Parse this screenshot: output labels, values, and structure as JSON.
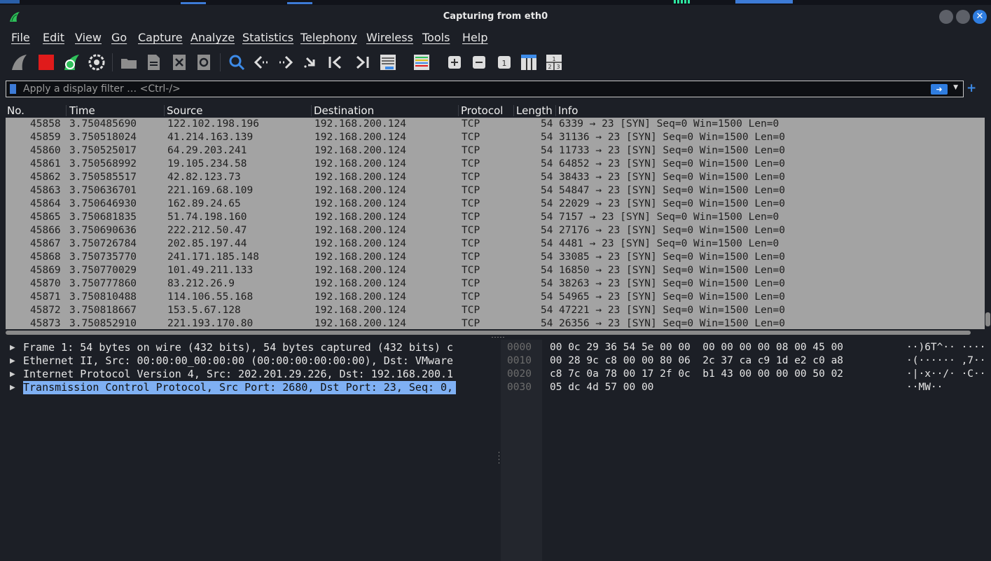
{
  "window": {
    "title": "Capturing from eth0"
  },
  "menu": [
    "File",
    "Edit",
    "View",
    "Go",
    "Capture",
    "Analyze",
    "Statistics",
    "Telephony",
    "Wireless",
    "Tools",
    "Help"
  ],
  "filter": {
    "placeholder": "Apply a display filter … <Ctrl-/>"
  },
  "columns": [
    "No.",
    "Time",
    "Source",
    "Destination",
    "Protocol",
    "Length",
    "Info"
  ],
  "packets": [
    {
      "no": "45858",
      "time": "3.750485690",
      "src": "122.102.198.196",
      "dst": "192.168.200.124",
      "proto": "TCP",
      "len": "54",
      "info": "6339 → 23 [SYN] Seq=0 Win=1500 Len=0"
    },
    {
      "no": "45859",
      "time": "3.750518024",
      "src": "41.214.163.139",
      "dst": "192.168.200.124",
      "proto": "TCP",
      "len": "54",
      "info": "31136 → 23 [SYN] Seq=0 Win=1500 Len=0"
    },
    {
      "no": "45860",
      "time": "3.750525017",
      "src": "64.29.203.241",
      "dst": "192.168.200.124",
      "proto": "TCP",
      "len": "54",
      "info": "11733 → 23 [SYN] Seq=0 Win=1500 Len=0"
    },
    {
      "no": "45861",
      "time": "3.750568992",
      "src": "19.105.234.58",
      "dst": "192.168.200.124",
      "proto": "TCP",
      "len": "54",
      "info": "64852 → 23 [SYN] Seq=0 Win=1500 Len=0"
    },
    {
      "no": "45862",
      "time": "3.750585517",
      "src": "42.82.123.73",
      "dst": "192.168.200.124",
      "proto": "TCP",
      "len": "54",
      "info": "38433 → 23 [SYN] Seq=0 Win=1500 Len=0"
    },
    {
      "no": "45863",
      "time": "3.750636701",
      "src": "221.169.68.109",
      "dst": "192.168.200.124",
      "proto": "TCP",
      "len": "54",
      "info": "54847 → 23 [SYN] Seq=0 Win=1500 Len=0"
    },
    {
      "no": "45864",
      "time": "3.750646930",
      "src": "162.89.24.65",
      "dst": "192.168.200.124",
      "proto": "TCP",
      "len": "54",
      "info": "22029 → 23 [SYN] Seq=0 Win=1500 Len=0"
    },
    {
      "no": "45865",
      "time": "3.750681835",
      "src": "51.74.198.160",
      "dst": "192.168.200.124",
      "proto": "TCP",
      "len": "54",
      "info": "7157 → 23 [SYN] Seq=0 Win=1500 Len=0"
    },
    {
      "no": "45866",
      "time": "3.750690636",
      "src": "222.212.50.47",
      "dst": "192.168.200.124",
      "proto": "TCP",
      "len": "54",
      "info": "27176 → 23 [SYN] Seq=0 Win=1500 Len=0"
    },
    {
      "no": "45867",
      "time": "3.750726784",
      "src": "202.85.197.44",
      "dst": "192.168.200.124",
      "proto": "TCP",
      "len": "54",
      "info": "4481 → 23 [SYN] Seq=0 Win=1500 Len=0"
    },
    {
      "no": "45868",
      "time": "3.750735770",
      "src": "241.171.185.148",
      "dst": "192.168.200.124",
      "proto": "TCP",
      "len": "54",
      "info": "33085 → 23 [SYN] Seq=0 Win=1500 Len=0"
    },
    {
      "no": "45869",
      "time": "3.750770029",
      "src": "101.49.211.133",
      "dst": "192.168.200.124",
      "proto": "TCP",
      "len": "54",
      "info": "16850 → 23 [SYN] Seq=0 Win=1500 Len=0"
    },
    {
      "no": "45870",
      "time": "3.750777860",
      "src": "83.212.26.9",
      "dst": "192.168.200.124",
      "proto": "TCP",
      "len": "54",
      "info": "38263 → 23 [SYN] Seq=0 Win=1500 Len=0"
    },
    {
      "no": "45871",
      "time": "3.750810488",
      "src": "114.106.55.168",
      "dst": "192.168.200.124",
      "proto": "TCP",
      "len": "54",
      "info": "54965 → 23 [SYN] Seq=0 Win=1500 Len=0"
    },
    {
      "no": "45872",
      "time": "3.750818667",
      "src": "153.5.67.128",
      "dst": "192.168.200.124",
      "proto": "TCP",
      "len": "54",
      "info": "47221 → 23 [SYN] Seq=0 Win=1500 Len=0"
    },
    {
      "no": "45873",
      "time": "3.750852910",
      "src": "221.193.170.80",
      "dst": "192.168.200.124",
      "proto": "TCP",
      "len": "54",
      "info": "26356 → 23 [SYN] Seq=0 Win=1500 Len=0"
    }
  ],
  "details": [
    {
      "text": "Frame 1: 54 bytes on wire (432 bits), 54 bytes captured (432 bits) c",
      "selected": false
    },
    {
      "text": "Ethernet II, Src: 00:00:00_00:00:00 (00:00:00:00:00:00), Dst: VMware",
      "selected": false
    },
    {
      "text": "Internet Protocol Version 4, Src: 202.201.29.226, Dst: 192.168.200.1",
      "selected": false
    },
    {
      "text": "Transmission Control Protocol, Src Port: 2680, Dst Port: 23, Seq: 0,",
      "selected": true
    }
  ],
  "hex": [
    {
      "offset": "0000",
      "bytes": "00 0c 29 36 54 5e 00 00  00 00 00 00 08 00 45 00",
      "ascii": "··)6T^·· ····"
    },
    {
      "offset": "0010",
      "bytes": "00 28 9c c8 00 00 80 06  2c 37 ca c9 1d e2 c0 a8",
      "ascii": "·(······ ,7··"
    },
    {
      "offset": "0020",
      "bytes": "c8 7c 0a 78 00 17 2f 0c  b1 43 00 00 00 00 50 02",
      "ascii": "·|·x··/· ·C··"
    },
    {
      "offset": "0030",
      "bytes": "05 dc 4d 57 00 00",
      "ascii": "··MW··"
    }
  ],
  "colors": {
    "accent": "#2f7de0",
    "list_bg": "#a3a3a3",
    "selected": "#7fb0f3",
    "stop": "#e01b1b",
    "start": "#2fc05a"
  }
}
